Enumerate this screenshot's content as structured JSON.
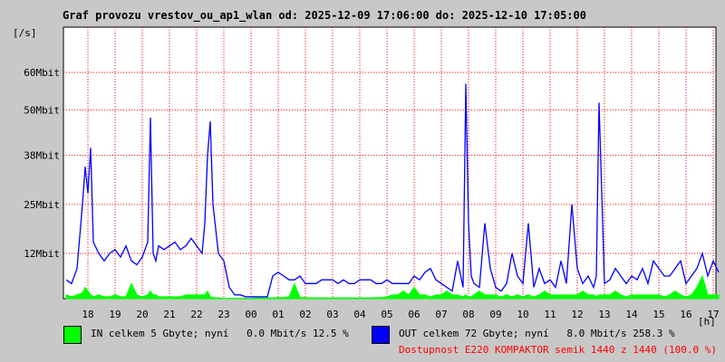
{
  "title": "Graf provozu vrestov_ou_ap1_wlan od: 2025-12-09 17:06:00 do: 2025-12-10 17:05:00",
  "y_unit": "[/s]",
  "x_unit": "[h]",
  "colors": {
    "in": "#00ff00",
    "out": "#0000ff",
    "grid": "#ff0000",
    "background": "#ffffff",
    "availability": "#ff0000"
  },
  "legend": {
    "in_text": "IN celkem 5 Gbyte; nyní   0.0 Mbit/s 12.5 %",
    "out_text": "OUT celkem 72 Gbyte; nyní   8.0 Mbit/s 258.3 %",
    "availability_text": "Dostupnost E220 KOMPAKTOR semik 1440 z 1440 (100.0 %)"
  },
  "chart_data": {
    "type": "area",
    "title": "Graf provozu vrestov_ou_ap1_wlan od: 2025-12-09 17:06:00 do: 2025-12-10 17:05:00",
    "ylabel": "[/s]",
    "xlabel": "[h]",
    "ylim": [
      0,
      72
    ],
    "yticks": [
      12,
      25,
      38,
      50,
      60
    ],
    "ytick_labels": [
      "12Mbit",
      "25Mbit",
      "38Mbit",
      "50Mbit",
      "60Mbit"
    ],
    "xtick_labels": [
      "18",
      "19",
      "20",
      "21",
      "22",
      "23",
      "00",
      "01",
      "02",
      "03",
      "04",
      "05",
      "06",
      "07",
      "08",
      "09",
      "10",
      "11",
      "12",
      "13",
      "14",
      "15",
      "16",
      "17"
    ],
    "grid": true,
    "x_hours": [
      17.2,
      17.4,
      17.6,
      17.8,
      17.9,
      18.0,
      18.1,
      18.2,
      18.4,
      18.6,
      18.8,
      19.0,
      19.2,
      19.4,
      19.6,
      19.8,
      20.0,
      20.2,
      20.3,
      20.4,
      20.5,
      20.6,
      20.8,
      21.0,
      21.2,
      21.4,
      21.6,
      21.8,
      22.0,
      22.2,
      22.3,
      22.4,
      22.5,
      22.6,
      22.8,
      23.0,
      23.2,
      23.4,
      23.6,
      23.8,
      24.0,
      24.2,
      24.4,
      24.6,
      24.8,
      25.0,
      25.2,
      25.4,
      25.6,
      25.8,
      26.0,
      26.2,
      26.4,
      26.6,
      26.8,
      27.0,
      27.2,
      27.4,
      27.6,
      27.8,
      28.0,
      28.2,
      28.4,
      28.6,
      28.8,
      29.0,
      29.2,
      29.4,
      29.6,
      29.8,
      30.0,
      30.2,
      30.4,
      30.6,
      30.8,
      31.0,
      31.2,
      31.4,
      31.6,
      31.8,
      31.9,
      32.0,
      32.1,
      32.2,
      32.4,
      32.6,
      32.8,
      33.0,
      33.2,
      33.4,
      33.6,
      33.8,
      34.0,
      34.2,
      34.4,
      34.6,
      34.8,
      35.0,
      35.2,
      35.4,
      35.6,
      35.8,
      36.0,
      36.2,
      36.4,
      36.6,
      36.7,
      36.8,
      37.0,
      37.2,
      37.4,
      37.6,
      37.8,
      38.0,
      38.2,
      38.4,
      38.6,
      38.8,
      39.0,
      39.2,
      39.4,
      39.6,
      39.8,
      40.0,
      40.2,
      40.4,
      40.6,
      40.8,
      41.0,
      41.2
    ],
    "series": [
      {
        "name": "IN",
        "color": "#00ff00",
        "values": [
          1,
          0.5,
          1,
          1.5,
          3,
          2,
          1,
          0.5,
          1,
          0.5,
          0.5,
          1,
          0.5,
          0.5,
          4,
          1,
          0.5,
          1,
          2,
          1,
          1,
          0.5,
          0.5,
          0.5,
          0.5,
          0.5,
          1,
          1,
          1,
          1,
          1,
          2,
          0.5,
          0.3,
          0.2,
          0.1,
          0.1,
          0.1,
          0.1,
          0.1,
          0.1,
          0.2,
          0.2,
          0.2,
          0.2,
          0.3,
          0.3,
          0.5,
          4,
          0.3,
          0.3,
          0.2,
          0.2,
          0.2,
          0.2,
          0.2,
          0.2,
          0.2,
          0.2,
          0.2,
          0.2,
          0.2,
          0.2,
          0.3,
          0.3,
          0.5,
          1,
          1,
          2,
          1,
          3,
          1,
          1,
          0.5,
          1,
          1,
          2,
          1,
          1,
          0.5,
          1,
          0.5,
          0.5,
          1,
          2,
          1,
          1,
          1,
          0.5,
          1,
          0.5,
          1,
          0.5,
          1,
          0.5,
          1,
          2,
          1,
          1,
          1,
          1,
          1,
          1,
          2,
          1,
          1,
          0.5,
          1,
          1,
          1,
          2,
          1,
          0.5,
          1,
          1,
          1,
          1,
          1,
          1,
          0.5,
          1,
          2,
          1,
          0.5,
          1,
          3,
          6,
          1,
          1,
          1,
          1,
          0.5,
          1
        ]
      },
      {
        "name": "OUT",
        "color": "#0000ff",
        "values": [
          5,
          4,
          8,
          25,
          35,
          28,
          40,
          15,
          12,
          10,
          12,
          13,
          11,
          14,
          10,
          9,
          11,
          15,
          48,
          12,
          10,
          14,
          13,
          14,
          15,
          13,
          14,
          16,
          14,
          12,
          20,
          38,
          47,
          25,
          12,
          10,
          3,
          1,
          1,
          0.5,
          0.5,
          0.5,
          0.5,
          0.5,
          6,
          7,
          6,
          5,
          5,
          6,
          4,
          4,
          4,
          5,
          5,
          5,
          4,
          5,
          4,
          4,
          5,
          5,
          5,
          4,
          4,
          5,
          4,
          4,
          4,
          4,
          6,
          5,
          7,
          8,
          5,
          4,
          3,
          2,
          10,
          3,
          57,
          20,
          6,
          4,
          3,
          20,
          8,
          3,
          2,
          4,
          12,
          6,
          4,
          20,
          3,
          8,
          4,
          5,
          3,
          10,
          4,
          25,
          8,
          4,
          6,
          3,
          6,
          52,
          4,
          5,
          8,
          6,
          4,
          6,
          5,
          8,
          4,
          10,
          8,
          6,
          6,
          8,
          10,
          4,
          6,
          8,
          12,
          6,
          10,
          7,
          8,
          10,
          12,
          6,
          9
        ]
      }
    ]
  }
}
